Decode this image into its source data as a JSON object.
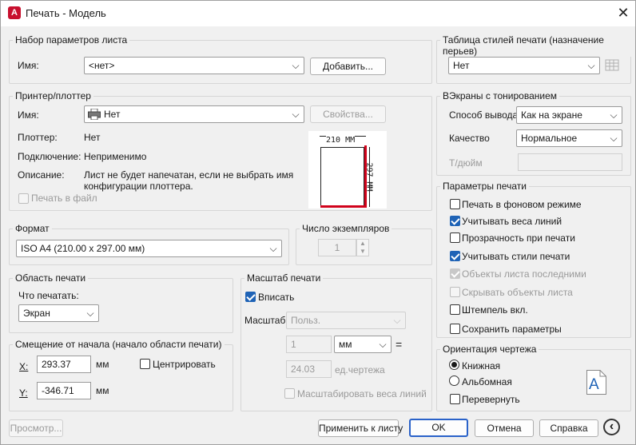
{
  "window": {
    "title": "Печать - Модель",
    "logo": "A"
  },
  "page_setup": {
    "legend": "Набор параметров листа",
    "name_label": "Имя:",
    "name_value": "<нет>",
    "add_button": "Добавить..."
  },
  "printer": {
    "legend": "Принтер/плоттер",
    "name_label": "Имя:",
    "name_value": "Нет",
    "properties_button": "Свойства...",
    "plotter_label": "Плоттер:",
    "plotter_value": "Нет",
    "connection_label": "Подключение:",
    "connection_value": "Неприменимо",
    "description_label": "Описание:",
    "description_line1": "Лист не будет напечатан, если не выбрать имя",
    "description_line2": "конфигурации плоттера.",
    "print_to_file": "Печать в файл",
    "preview_width": "210 ММ",
    "preview_height": "297 ММ"
  },
  "paper_size": {
    "legend": "Формат",
    "value": "ISO A4 (210.00 x 297.00 мм)"
  },
  "copies": {
    "legend": "Число экземпляров",
    "value": "1"
  },
  "plot_area": {
    "legend": "Область печати",
    "what_label": "Что печатать:",
    "what_value": "Экран"
  },
  "plot_offset": {
    "legend": "Смещение от начала (начало области печати)",
    "x_label": "X:",
    "x_value": "293.37",
    "x_unit": "мм",
    "y_label": "Y:",
    "y_value": "-346.71",
    "y_unit": "мм",
    "center_label": "Центрировать"
  },
  "plot_scale": {
    "legend": "Масштаб печати",
    "fit_label": "Вписать",
    "scale_label": "Масштаб:",
    "scale_value": "Польз.",
    "value1": "1",
    "unit1": "мм",
    "equals": "=",
    "value2": "24.03",
    "unit2": "ед.чертежа",
    "scale_lineweights": "Масштабировать веса линий"
  },
  "plot_style_table": {
    "legend": "Таблица стилей печати (назначение перьев)",
    "value": "Нет"
  },
  "shaded_viewport": {
    "legend": "ВЭкраны с тонированием",
    "shade_label": "Способ вывода",
    "shade_value": "Как на экране",
    "quality_label": "Качество",
    "quality_value": "Нормальное",
    "dpi_label": "Т/дюйм"
  },
  "plot_options": {
    "legend": "Параметры печати",
    "items": [
      {
        "label": "Печать в фоновом режиме",
        "checked": false,
        "disabled": false
      },
      {
        "label": "Учитывать веса линий",
        "checked": true,
        "disabled": false
      },
      {
        "label": "Прозрачность при печати",
        "checked": false,
        "disabled": false
      },
      {
        "label": "Учитывать стили печати",
        "checked": true,
        "disabled": false
      },
      {
        "label": "Объекты листа последними",
        "checked": true,
        "disabled": true
      },
      {
        "label": "Скрывать объекты листа",
        "checked": false,
        "disabled": true
      },
      {
        "label": "Штемпель вкл.",
        "checked": false,
        "disabled": false
      },
      {
        "label": "Сохранить параметры",
        "checked": false,
        "disabled": false
      }
    ]
  },
  "orientation": {
    "legend": "Ориентация чертежа",
    "portrait": "Книжная",
    "landscape": "Альбомная",
    "upside_down": "Перевернуть",
    "icon_letter": "A"
  },
  "footer": {
    "preview_button": "Просмотр...",
    "apply_button": "Применить к листу",
    "ok_button": "OK",
    "cancel_button": "Отмена",
    "help_button": "Справка",
    "collapse_icon": "‹"
  }
}
